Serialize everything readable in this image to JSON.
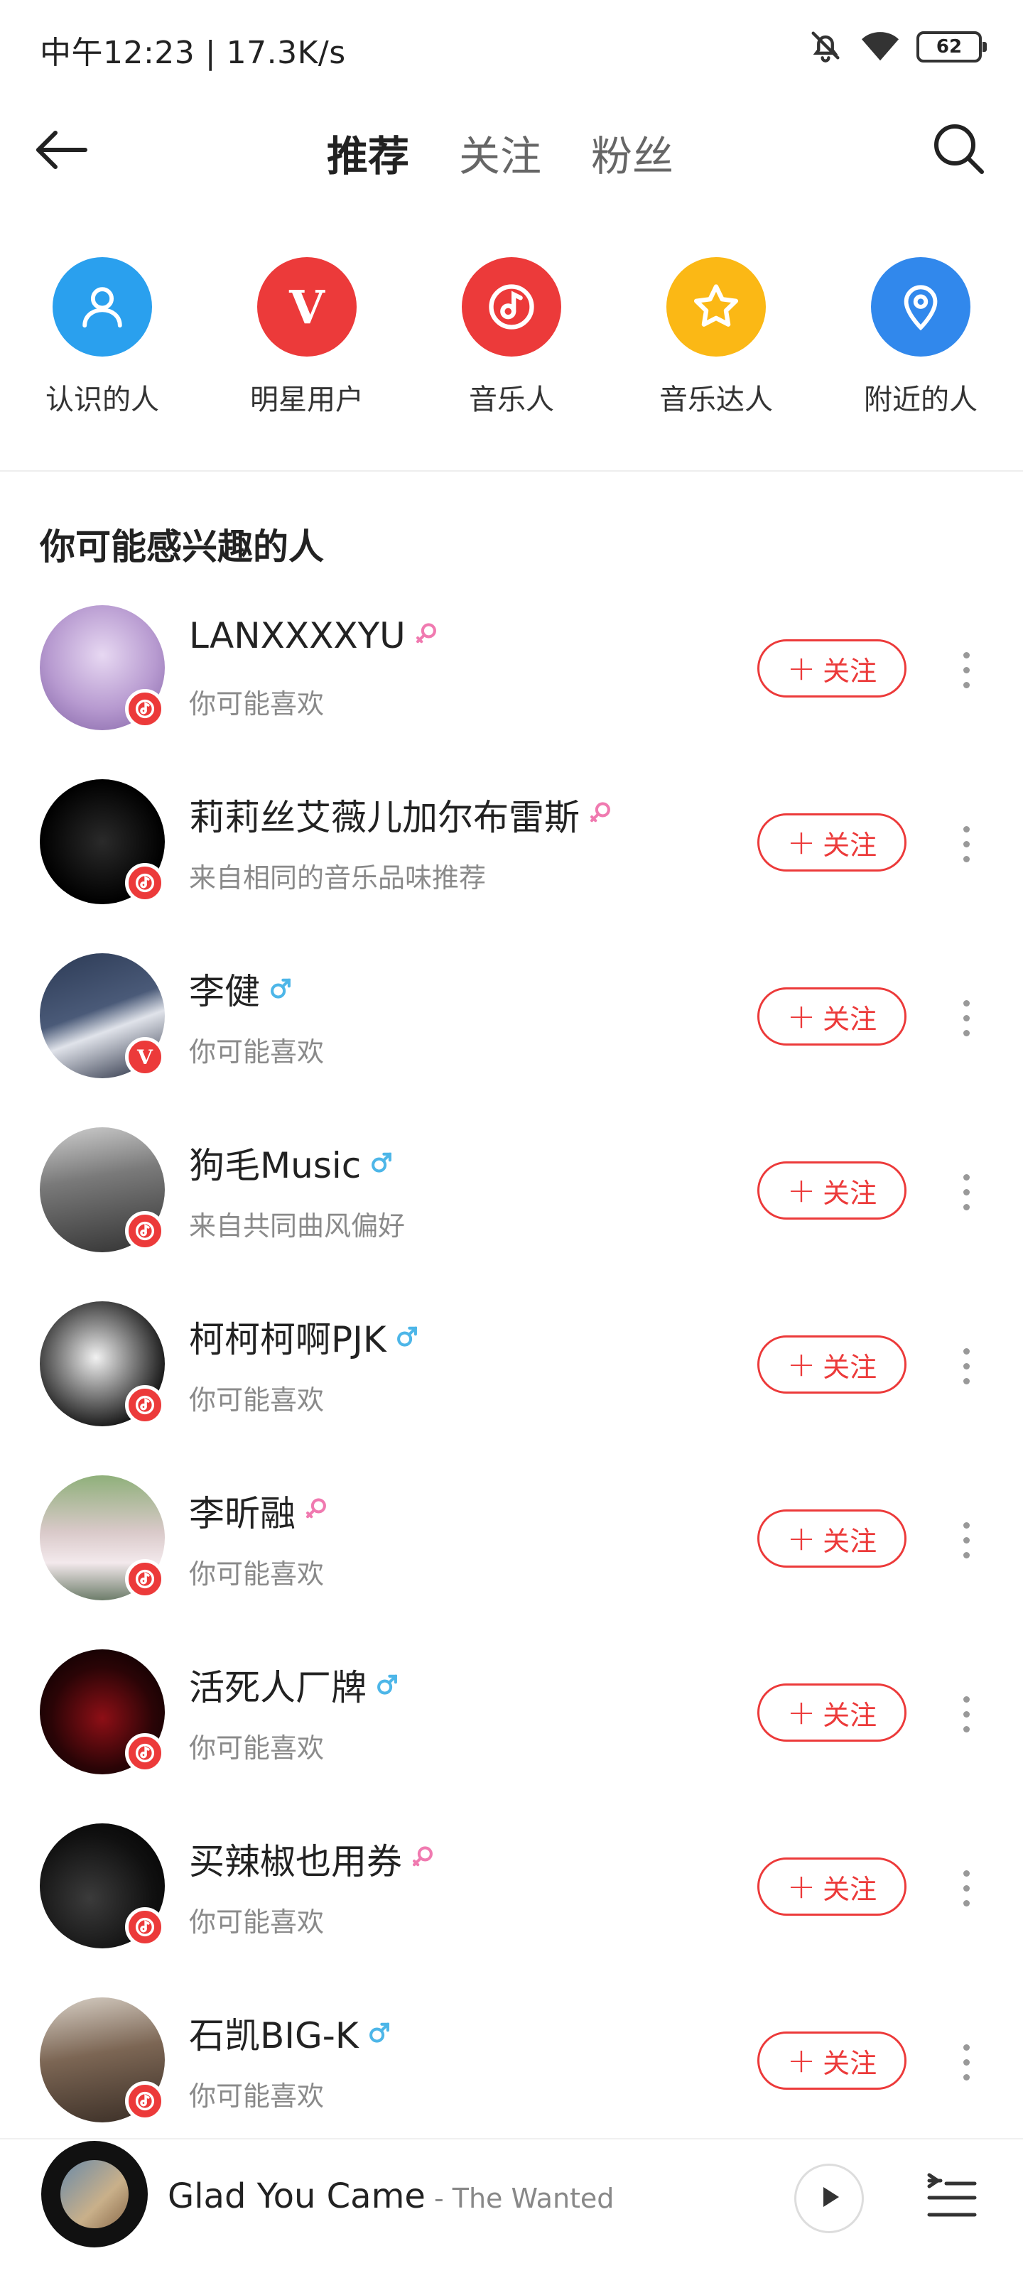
{
  "status_bar": {
    "time": "中午12:23 | 17.3K/s",
    "battery": "62",
    "icons": [
      "mute-bell-icon",
      "wifi-icon",
      "battery-icon"
    ]
  },
  "nav": {
    "tabs": [
      {
        "label": "推荐",
        "active": true
      },
      {
        "label": "关注",
        "active": false
      },
      {
        "label": "粉丝",
        "active": false
      }
    ],
    "back_icon": "back-arrow-icon",
    "search_icon": "search-icon"
  },
  "categories": [
    {
      "label": "认识的人",
      "icon": "person-icon",
      "color": "#2aa0ee"
    },
    {
      "label": "明星用户",
      "icon": "v-icon",
      "color": "#ec3a3a"
    },
    {
      "label": "音乐人",
      "icon": "music-note-icon",
      "color": "#ec3a3a"
    },
    {
      "label": "音乐达人",
      "icon": "star-icon",
      "color": "#fbb815"
    },
    {
      "label": "附近的人",
      "icon": "location-pin-icon",
      "color": "#3188ec"
    }
  ],
  "section_title": "你可能感兴趣的人",
  "users": [
    {
      "name": "LANXXXXYU",
      "gender": "female",
      "reason": "你可能喜欢",
      "badge": "music",
      "follow_label": "关注"
    },
    {
      "name": "莉莉丝艾薇儿加尔布雷斯",
      "gender": "female",
      "reason": "来自相同的音乐品味推荐",
      "badge": "music",
      "follow_label": "关注"
    },
    {
      "name": "李健",
      "gender": "male",
      "reason": "你可能喜欢",
      "badge": "v",
      "follow_label": "关注"
    },
    {
      "name": "狗毛Music",
      "gender": "male",
      "reason": "来自共同曲风偏好",
      "badge": "music",
      "follow_label": "关注"
    },
    {
      "name": "柯柯柯啊PJK",
      "gender": "male",
      "reason": "你可能喜欢",
      "badge": "music",
      "follow_label": "关注"
    },
    {
      "name": "李昕融",
      "gender": "female",
      "reason": "你可能喜欢",
      "badge": "music",
      "follow_label": "关注"
    },
    {
      "name": "活死人厂牌",
      "gender": "male",
      "reason": "你可能喜欢",
      "badge": "music",
      "follow_label": "关注"
    },
    {
      "name": "买辣椒也用券",
      "gender": "female",
      "reason": "你可能喜欢",
      "badge": "music",
      "follow_label": "关注"
    },
    {
      "name": "石凯BIG-K",
      "gender": "male",
      "reason": "你可能喜欢",
      "badge": "music",
      "follow_label": "关注"
    }
  ],
  "player": {
    "title": "Glad You Came",
    "separator": " - ",
    "artist": "The Wanted"
  },
  "colors": {
    "accent": "#ec3a3a",
    "female": "#f07ab0",
    "male": "#4db6e8"
  }
}
